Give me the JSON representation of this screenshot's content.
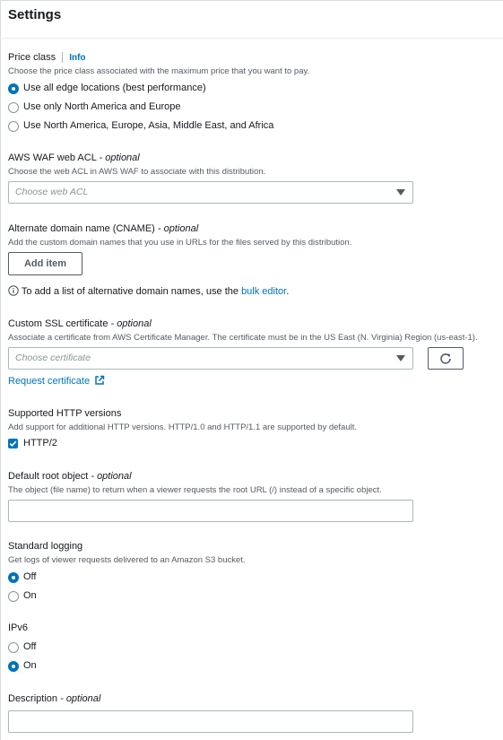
{
  "settings": {
    "title": "Settings"
  },
  "price_class": {
    "label": "Price class",
    "info": "Info",
    "description": "Choose the price class associated with the maximum price that you want to pay.",
    "options": [
      "Use all edge locations (best performance)",
      "Use only North America and Europe",
      "Use North America, Europe, Asia, Middle East, and Africa"
    ],
    "selected": 0
  },
  "waf": {
    "label": "AWS WAF web ACL",
    "optional": "- optional",
    "description": "Choose the web ACL in AWS WAF to associate with this distribution.",
    "placeholder": "Choose web ACL"
  },
  "cname": {
    "label": "Alternate domain name (CNAME)",
    "optional": "- optional",
    "description": "Add the custom domain names that you use in URLs for the files served by this distribution.",
    "add_button": "Add item",
    "info_text": "To add a list of alternative domain names, use the",
    "info_link": "bulk editor",
    "info_end": "."
  },
  "ssl": {
    "label": "Custom SSL certificate",
    "optional": "- optional",
    "description": "Associate a certificate from AWS Certificate Manager. The certificate must be in the US East (N. Virginia) Region (us-east-1).",
    "placeholder": "Choose certificate",
    "request_link": "Request certificate"
  },
  "http": {
    "label": "Supported HTTP versions",
    "description": "Add support for additional HTTP versions. HTTP/1.0 and HTTP/1.1 are supported by default.",
    "option": "HTTP/2",
    "checked": true
  },
  "root_object": {
    "label": "Default root object",
    "optional": "- optional",
    "description": "The object (file name) to return when a viewer requests the root URL (/) instead of a specific object.",
    "value": ""
  },
  "logging": {
    "label": "Standard logging",
    "description": "Get logs of viewer requests delivered to an Amazon S3 bucket.",
    "options": [
      "Off",
      "On"
    ],
    "selected": "Off"
  },
  "ipv6": {
    "label": "IPv6",
    "options": [
      "Off",
      "On"
    ],
    "selected": "On"
  },
  "description_field": {
    "label": "Description",
    "optional": "- optional",
    "value": ""
  }
}
